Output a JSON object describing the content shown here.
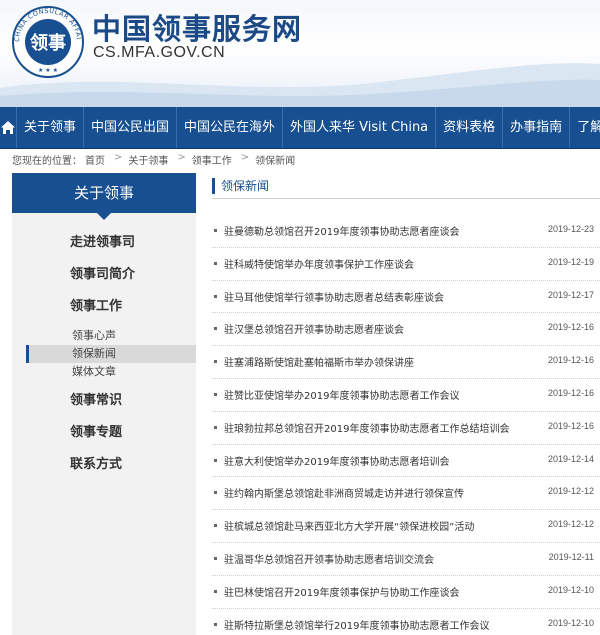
{
  "header": {
    "title": "中国领事服务网",
    "url": "CS.MFA.GOV.CN",
    "logo_text": "CHINA CONSULAR AFFAIRS"
  },
  "nav": {
    "home_icon": "home-icon",
    "items": [
      "关于领事",
      "中国公民出国",
      "中国公民在海外",
      "外国人来华 Visit China",
      "资料表格",
      "办事指南",
      "了解"
    ]
  },
  "breadcrumb": {
    "prefix": "您现在的位置：",
    "items": [
      "首页",
      "关于领事",
      "领事工作",
      "领保新闻"
    ]
  },
  "sidebar": {
    "title": "关于领事",
    "items": [
      "走进领事司",
      "领事司简介",
      "领事工作"
    ],
    "subitems": [
      "领事心声",
      "领保新闻",
      "媒体文章"
    ],
    "items_after": [
      "领事常识",
      "领事专题",
      "联系方式"
    ]
  },
  "main": {
    "title": "领保新闻",
    "news": [
      {
        "title": "驻曼德勒总领馆召开2019年度领事协助志愿者座谈会",
        "date": "2019-12-23"
      },
      {
        "title": "驻科威特使馆举办年度领事保护工作座谈会",
        "date": "2019-12-19"
      },
      {
        "title": "驻马耳他使馆举行领事协助志愿者总结表彰座谈会",
        "date": "2019-12-17"
      },
      {
        "title": "驻汉堡总领馆召开领事协助志愿者座谈会",
        "date": "2019-12-16"
      },
      {
        "title": "驻塞浦路斯使馆赴塞帕福斯市举办领保讲座",
        "date": "2019-12-16"
      },
      {
        "title": "驻赞比亚使馆举办2019年度领事协助志愿者工作会议",
        "date": "2019-12-16"
      },
      {
        "title": "驻琅勃拉邦总领馆召开2019年度领事协助志愿者工作总结培训会",
        "date": "2019-12-16"
      },
      {
        "title": "驻意大利使馆举办2019年度领事协助志愿者培训会",
        "date": "2019-12-14"
      },
      {
        "title": "驻约翰内斯堡总领馆赴非洲商贸城走访并进行领保宣传",
        "date": "2019-12-12"
      },
      {
        "title": "驻槟城总领馆赴马来西亚北方大学开展“领保进校园”活动",
        "date": "2019-12-12"
      },
      {
        "title": "驻温哥华总领馆召开领事协助志愿者培训交流会",
        "date": "2019-12-11"
      },
      {
        "title": "驻巴林使馆召开2019年度领事保护与协助工作座谈会",
        "date": "2019-12-10"
      },
      {
        "title": "驻斯特拉斯堡总领馆举行2019年度领事协助志愿者工作会议",
        "date": "2019-12-10"
      }
    ]
  },
  "colors": {
    "primary": "#174f91",
    "sidebar_bg": "#f2f2f2",
    "active_sub_bg": "#d9d9d9"
  }
}
